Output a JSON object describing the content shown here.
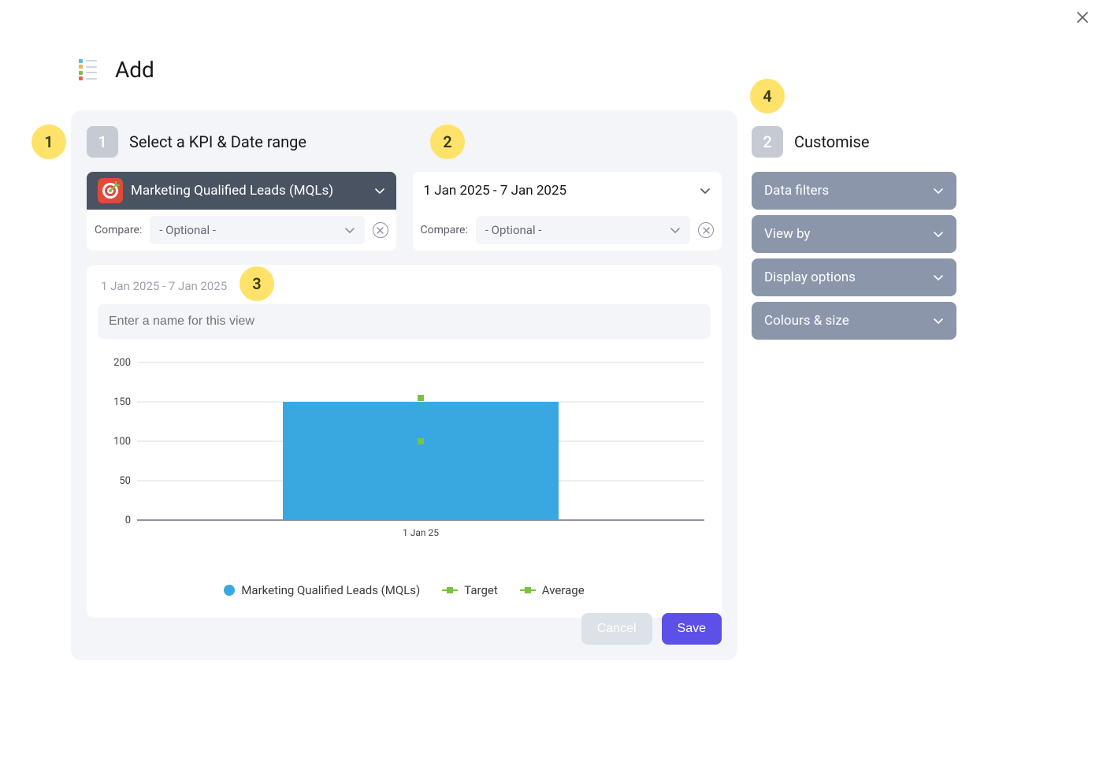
{
  "page_title": "Add",
  "close_label": "Close",
  "annotations": {
    "1": "1",
    "2": "2",
    "3": "3",
    "4": "4"
  },
  "step1": {
    "number": "1",
    "title": "Select a KPI & Date range",
    "kpi_selector": {
      "label": "Marketing Qualified Leads (MQLs)"
    },
    "kpi_compare": {
      "label": "Compare:",
      "value": "- Optional -"
    },
    "date_selector": {
      "label": "1 Jan 2025 - 7 Jan 2025"
    },
    "date_compare": {
      "label": "Compare:",
      "value": "- Optional -"
    }
  },
  "preview": {
    "date_subtitle": "1 Jan 2025 - 7 Jan 2025",
    "name_placeholder": "Enter a name for this view"
  },
  "chart_data": {
    "type": "bar",
    "categories": [
      "1 Jan 25"
    ],
    "values": [
      150
    ],
    "target": [
      155
    ],
    "average": [
      100
    ],
    "ylabel": "",
    "ylim": [
      0,
      200
    ],
    "yticks": [
      0,
      50,
      100,
      150,
      200
    ],
    "legend": {
      "series": "Marketing Qualified Leads (MQLs)",
      "target": "Target",
      "average": "Average"
    },
    "colors": {
      "bar": "#3aa8e0",
      "target": "#7ac243",
      "average": "#7ac243"
    }
  },
  "actions": {
    "cancel": "Cancel",
    "save": "Save"
  },
  "step2": {
    "number": "2",
    "title": "Customise",
    "accordion": [
      "Data filters",
      "View by",
      "Display options",
      "Colours & size"
    ]
  }
}
